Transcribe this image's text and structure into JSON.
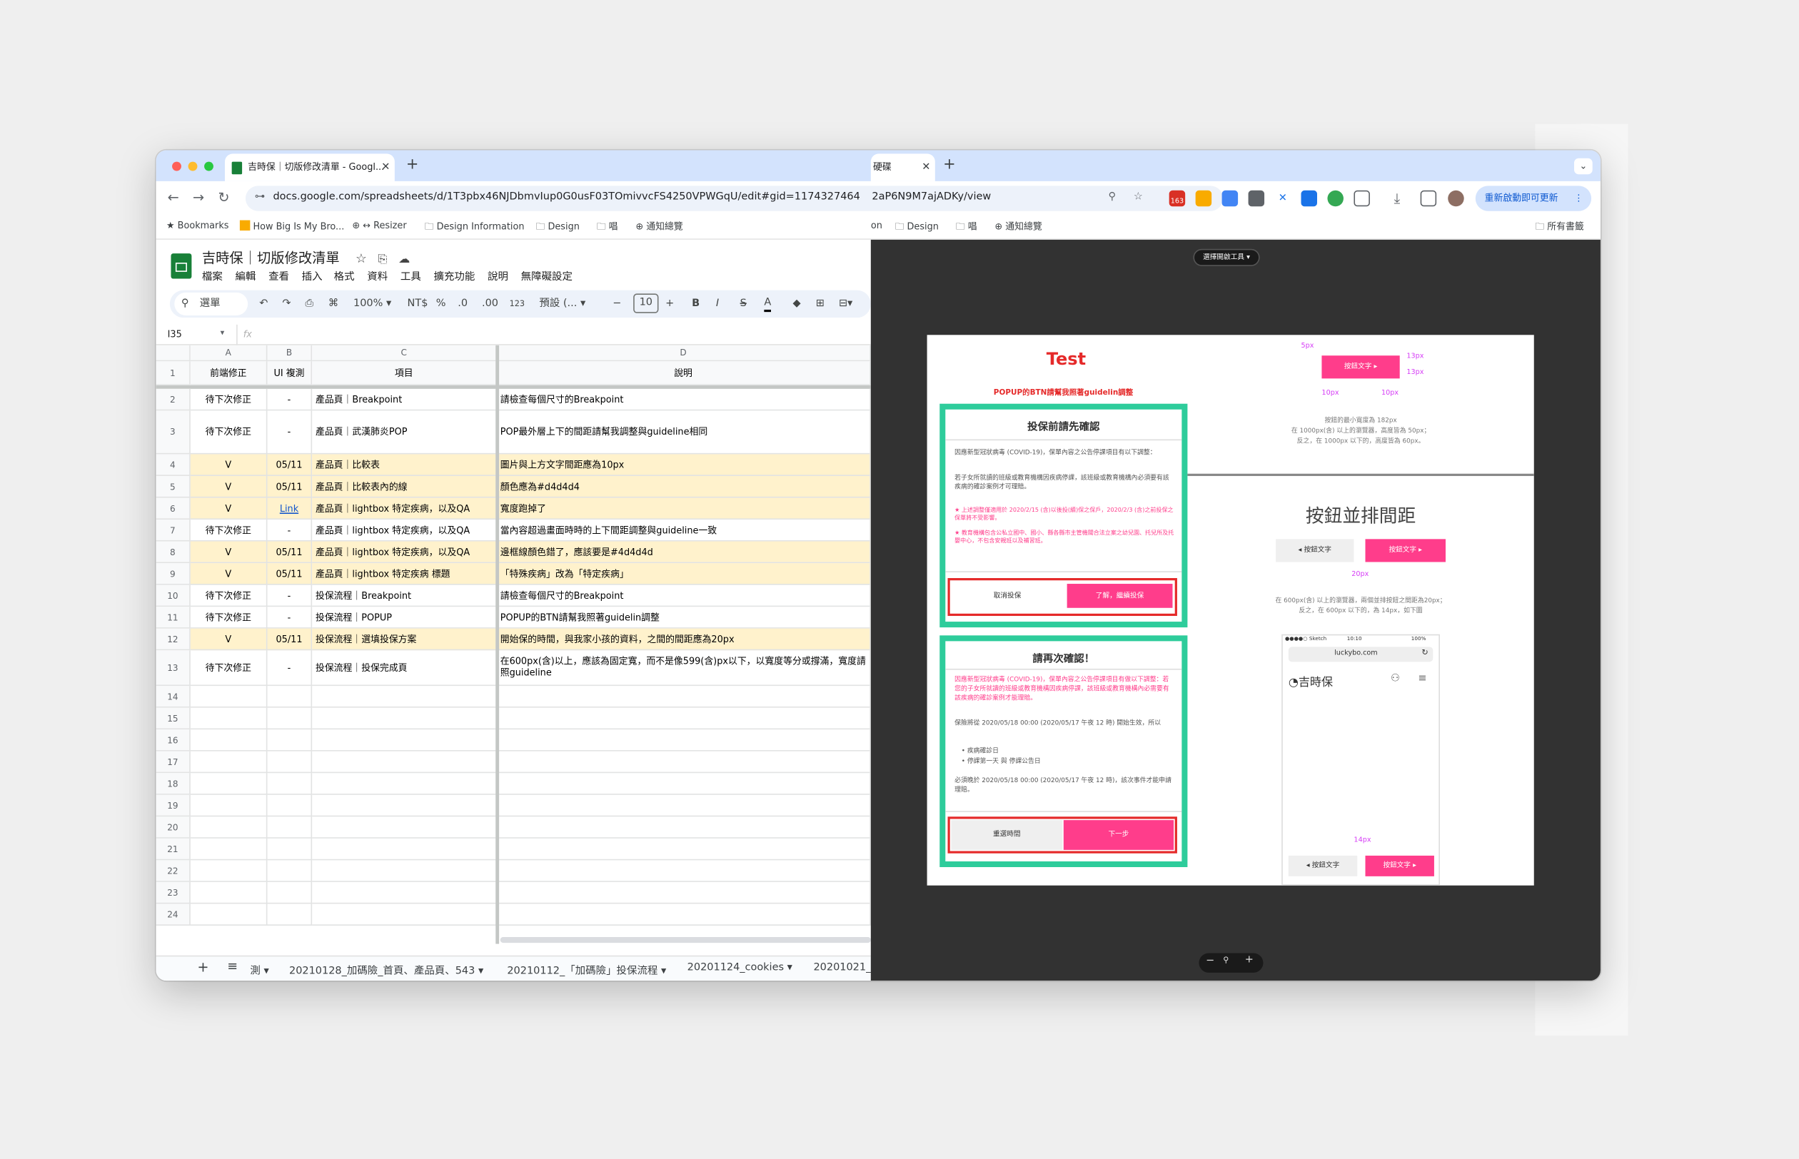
{
  "browser": {
    "left_tab_title": "吉時保｜切版修改清單 - Googl...",
    "right_tab_title": "硬碟",
    "left_url": "docs.google.com/spreadsheets/d/1T3pbx46NJDbmvIup0G0usF03TOmivvcFS4250VPWGqU/edit#gid=1174327464",
    "right_url": "2aP6N9M7ajADKy/view",
    "update_button": "重新啟動即可更新",
    "ext_badge": "163",
    "bookmarks_left": [
      "Bookmarks",
      "How Big Is My Bro...",
      "↔ Resizer",
      "Design Information",
      "Design",
      "唱",
      "通知總覽"
    ],
    "bookmarks_right": [
      "on",
      "Design",
      "唱",
      "通知總覽"
    ],
    "all_bookmarks": "所有書籤",
    "colors": {
      "tabstrip": "#d3e3fd",
      "sheets_green": "#188038",
      "highlight": "#fff2cc",
      "pink": "#ff3d8b",
      "teal": "#2ecc9b",
      "viewer_bg": "#323232"
    }
  },
  "sheet": {
    "title": "吉時保｜切版修改清單",
    "menus": [
      "檔案",
      "編輯",
      "查看",
      "插入",
      "格式",
      "資料",
      "工具",
      "擴充功能",
      "說明",
      "無障礙設定"
    ],
    "toolbar": {
      "search": "選單",
      "zoom": "100%",
      "currency": "NT$",
      "percent": "%",
      "dec_minus": ".0",
      "dec_plus": ".00",
      "num": "123",
      "font": "預設 (...",
      "size": "10",
      "bold": "B",
      "italic": "I",
      "strike": "S",
      "color": "A"
    },
    "namebox": "I35",
    "fx": "fx",
    "columns": [
      "A",
      "B",
      "C",
      "D"
    ],
    "header": [
      "前端修正",
      "UI 複測",
      "項目",
      "說明"
    ],
    "rows": [
      {
        "n": "2",
        "a": "待下次修正",
        "b": "-",
        "c": "產品頁｜Breakpoint",
        "d": "請檢查每個尺寸的Breakpoint"
      },
      {
        "n": "3",
        "a": "待下次修正",
        "b": "-",
        "c": "產品頁｜武漢肺炎POP",
        "d": "POP最外層上下的間距請幫我調整與guideline相同"
      },
      {
        "n": "4",
        "a": "V",
        "b": "05/11",
        "c": "產品頁｜比較表",
        "d": "圖片與上方文字間距應為10px"
      },
      {
        "n": "5",
        "a": "V",
        "b": "05/11",
        "c": "產品頁｜比較表內的線",
        "d": "顏色應為#d4d4d4"
      },
      {
        "n": "6",
        "a": "V",
        "b": "Link",
        "c": "產品頁｜lightbox 特定疾病，以及QA",
        "d": "寬度跑掉了"
      },
      {
        "n": "7",
        "a": "待下次修正",
        "b": "-",
        "c": "產品頁｜lightbox 特定疾病，以及QA",
        "d": "當內容超過畫面時時的上下間距調整與guideline一致"
      },
      {
        "n": "8",
        "a": "V",
        "b": "05/11",
        "c": "產品頁｜lightbox 特定疾病，以及QA",
        "d": "邊框線顏色錯了，應該要是#4d4d4d"
      },
      {
        "n": "9",
        "a": "V",
        "b": "05/11",
        "c": "產品頁｜lightbox 特定疾病 標題",
        "d": "「特殊疾病」改為「特定疾病」"
      },
      {
        "n": "10",
        "a": "待下次修正",
        "b": "-",
        "c": "投保流程｜Breakpoint",
        "d": "請檢查每個尺寸的Breakpoint"
      },
      {
        "n": "11",
        "a": "待下次修正",
        "b": "-",
        "c": "投保流程｜POPUP",
        "d": "POPUP的BTN請幫我照著guidelin調整"
      },
      {
        "n": "12",
        "a": "V",
        "b": "05/11",
        "c": "投保流程｜選填投保方案",
        "d": "開始保的時間，與我家小孩的資料，之間的間距應為20px"
      },
      {
        "n": "13",
        "a": "待下次修正",
        "b": "-",
        "c": "投保流程｜投保完成頁",
        "d": "在600px(含)以上，應該為固定寬，而不是像599(含)px以下，以寬度等分或撐滿，寬度請照guideline"
      }
    ],
    "empty_rows": [
      "14",
      "15",
      "16",
      "17",
      "18",
      "19",
      "20",
      "21",
      "22",
      "23",
      "24"
    ],
    "sheet_tabs": [
      "測",
      "20210128_加碼險_首頁、產品頁、543",
      "20210112_「加碼險」投保流程",
      "20201124_cookies",
      "20201021_"
    ]
  },
  "viewer": {
    "open_with": "選擇開啟工具",
    "test_title": "Test",
    "popup_note": "POPUP的BTN請幫我照著guidelin調整",
    "dialog1": {
      "title": "投保前請先確認",
      "p1": "因應新型冠狀病毒 (COVID-19)，保單內容之公告停課項目有以下調整：",
      "p2": "若子女所就讀的班級或教育機構因疾病停課，該班級或教育機構內必須要有該疾病的確診案例才可理賠。",
      "n1": "★ 上述調整僅適用於 2020/2/15 (含)以後投(續)保之保戶，2020/2/3 (含)之前投保之保單將不受影響。",
      "n2": "★ 教育機構包含公私立國中、國小、縣各縣市主管機關合法立案之幼兒園、托兒所及托嬰中心，不包含安親班以及補習班。",
      "cancel": "取消投保",
      "ok": "了解，繼續投保"
    },
    "dialog2": {
      "title": "請再次確認！",
      "p1": "因應新型冠狀病毒 (COVID-19)，保單內容之公告停課項目有做以下調整：若您的子女所就讀的班級或教育機構因疾病停課，該班級或教育機構內必需要有該疾病的確診案例才能理賠。",
      "p2": "保險將從 2020/05/18 00:00 (2020/05/17 午夜 12 時) 開始生效，所以",
      "li1": "疾病確診日",
      "li2": "停課第一天 與 停課公告日",
      "p3": "必須晚於 2020/05/18 00:00 (2020/05/17 午夜 12 時)，該次事件才能申請理賠。",
      "reselect": "重選時間",
      "next": "下一步"
    },
    "spec": {
      "btn_label": "按鈕文字 ▸",
      "dim_5": "5px",
      "dim_13a": "13px",
      "dim_13b": "13px",
      "dim_10a": "10px",
      "dim_10b": "10px",
      "note": [
        "按鈕的最小寬度為 182px",
        "在 1000px(含) 以上的瀏覽器，高度皆為 50px；",
        "反之，在 1000px 以下的，高度皆為 60px。"
      ],
      "section_title": "按鈕並排間距",
      "btn_grey": "◂ 按鈕文字",
      "btn_pink": "按鈕文字 ▸",
      "dim_20": "20px",
      "note2": [
        "在 600px(含) 以上的瀏覽器，兩個並排按鈕之間距為20px；",
        "反之，在 600px 以下的，為 14px，如下圖"
      ],
      "phone_status_left": "●●●●○ Sketch",
      "phone_status_mid": "10:10",
      "phone_status_right": "100%",
      "phone_url": "luckybo.com",
      "phone_logo": "吉時保",
      "dim_14": "14px"
    },
    "zoom": {
      "minus": "−",
      "fit": "🔍",
      "plus": "+"
    }
  }
}
